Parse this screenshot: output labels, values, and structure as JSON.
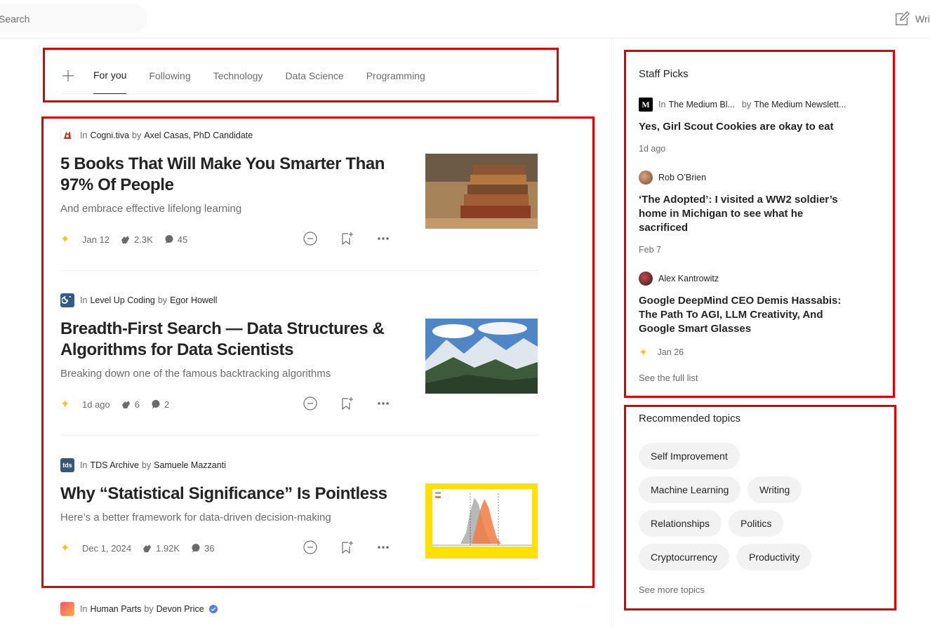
{
  "search": {
    "placeholder": "Search"
  },
  "header": {
    "write_label": "Write"
  },
  "tabs": [
    {
      "label": "For you",
      "active": true
    },
    {
      "label": "Following"
    },
    {
      "label": "Technology"
    },
    {
      "label": "Data Science"
    },
    {
      "label": "Programming"
    }
  ],
  "articles": [
    {
      "publication": "Cogni.tiva",
      "author": "Axel Casas, PhD Candidate",
      "title": "5 Books That Will Make You Smarter Than 97% Of People",
      "subtitle": "And embrace effective lifelong learning",
      "date": "Jan 12",
      "claps": "2.3K",
      "responses": "45",
      "thumbnail": "stack-of-books"
    },
    {
      "publication": "Level Up Coding",
      "author": "Egor Howell",
      "title": "Breadth-First Search — Data Structures & Algorithms for Data Scientists",
      "subtitle": "Breaking down one of the famous backtracking algorithms",
      "date": "1d ago",
      "claps": "6",
      "responses": "2",
      "thumbnail": "snowy-mountains"
    },
    {
      "publication": "TDS Archive",
      "author": "Samuele Mazzanti",
      "title": "Why “Statistical Significance” Is Pointless",
      "subtitle": "Here’s a better framework for data-driven decision-making",
      "date": "Dec 1, 2024",
      "claps": "1.92K",
      "responses": "36",
      "thumbnail": "permutation-bootstrap-histogram"
    },
    {
      "publication": "Human Parts",
      "author": "Devon Price"
    }
  ],
  "staff_picks": {
    "title": "Staff Picks",
    "items": [
      {
        "publication": "The Medium Bl...",
        "author": "The Medium Newslett...",
        "title": "Yes, Girl Scout Cookies are okay to eat",
        "date": "1d ago"
      },
      {
        "author": "Rob O’Brien",
        "title": "‘The Adopted’: I visited a WW2 soldier’s home in Michigan to see what he sacrificed",
        "date": "Feb 7"
      },
      {
        "author": "Alex Kantrowitz",
        "title": "Google DeepMind CEO Demis Hassabis: The Path To AGI, LLM Creativity, And Google Smart Glasses",
        "date": "Jan 26"
      }
    ],
    "see_full_list": "See the full list"
  },
  "recommended_topics": {
    "title": "Recommended topics",
    "chips": [
      "Self Improvement",
      "Machine Learning",
      "Writing",
      "Relationships",
      "Politics",
      "Cryptocurrency",
      "Productivity"
    ],
    "see_more": "See more topics"
  },
  "labels": {
    "in": "In",
    "by": "by"
  },
  "colors": {
    "highlight_box": "#e00000",
    "member_star": "#ffc017",
    "verified_badge": "#4d7cfe"
  }
}
